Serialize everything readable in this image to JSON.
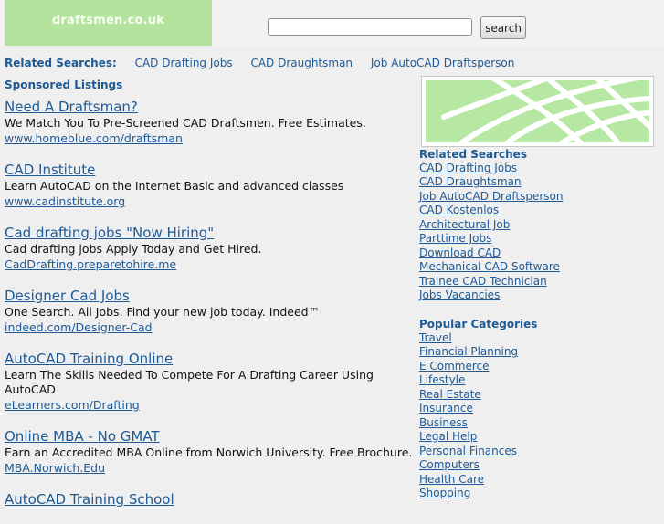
{
  "header": {
    "logo_text": "draftsmen.co.uk",
    "search_value": "",
    "search_button": "search"
  },
  "related_bar": {
    "label": "Related Searches:",
    "links": [
      "CAD Drafting Jobs",
      "CAD Draughtsman",
      "Job AutoCAD Draftsperson"
    ]
  },
  "sponsored_label": "Sponsored Listings",
  "listings": [
    {
      "title": "Need A Draftsman?",
      "desc": "We Match You To Pre-Screened CAD Draftsmen. Free Estimates.",
      "url": "www.homeblue.com/draftsman"
    },
    {
      "title": "CAD Institute",
      "desc": "Learn AutoCAD on the Internet Basic and advanced classes",
      "url": "www.cadinstitute.org"
    },
    {
      "title": "Cad drafting jobs \"Now Hiring\"",
      "desc": "Cad drafting jobs Apply Today and Get Hired.",
      "url": "CadDrafting.preparetohire.me"
    },
    {
      "title": "Designer Cad Jobs",
      "desc": "One Search. All Jobs. Find your new job today. Indeed™",
      "url": "indeed.com/Designer-Cad"
    },
    {
      "title": "AutoCAD Training Online",
      "desc": "Learn The Skills Needed To Compete For A Drafting Career Using AutoCAD",
      "url": "eLearners.com/Drafting"
    },
    {
      "title": "Online MBA - No GMAT",
      "desc": "Earn an Accredited MBA Online from Norwich University. Free Brochure.",
      "url": "MBA.Norwich.Edu"
    },
    {
      "title": "AutoCAD Training School",
      "desc": "",
      "url": ""
    }
  ],
  "sidebar": {
    "related_heading": "Related Searches",
    "related_links": [
      "CAD Drafting Jobs",
      "CAD Draughtsman",
      "Job AutoCAD Draftsperson",
      "CAD Kostenlos",
      "Architectural Job",
      "Parttime Jobs",
      "Download CAD",
      "Mechanical CAD Software",
      "Trainee CAD Technician",
      "Jobs Vacancies"
    ],
    "popular_heading": "Popular Categories",
    "popular_links": [
      "Travel",
      "Financial Planning",
      "E Commerce",
      "Lifestyle",
      "Real Estate",
      "Insurance",
      "Business",
      "Legal Help",
      "Personal Finances",
      "Computers",
      "Health Care",
      "Shopping"
    ]
  },
  "colors": {
    "logo_bg": "#b3e39c",
    "link": "#1f5a94",
    "page_bg": "#efefef"
  }
}
